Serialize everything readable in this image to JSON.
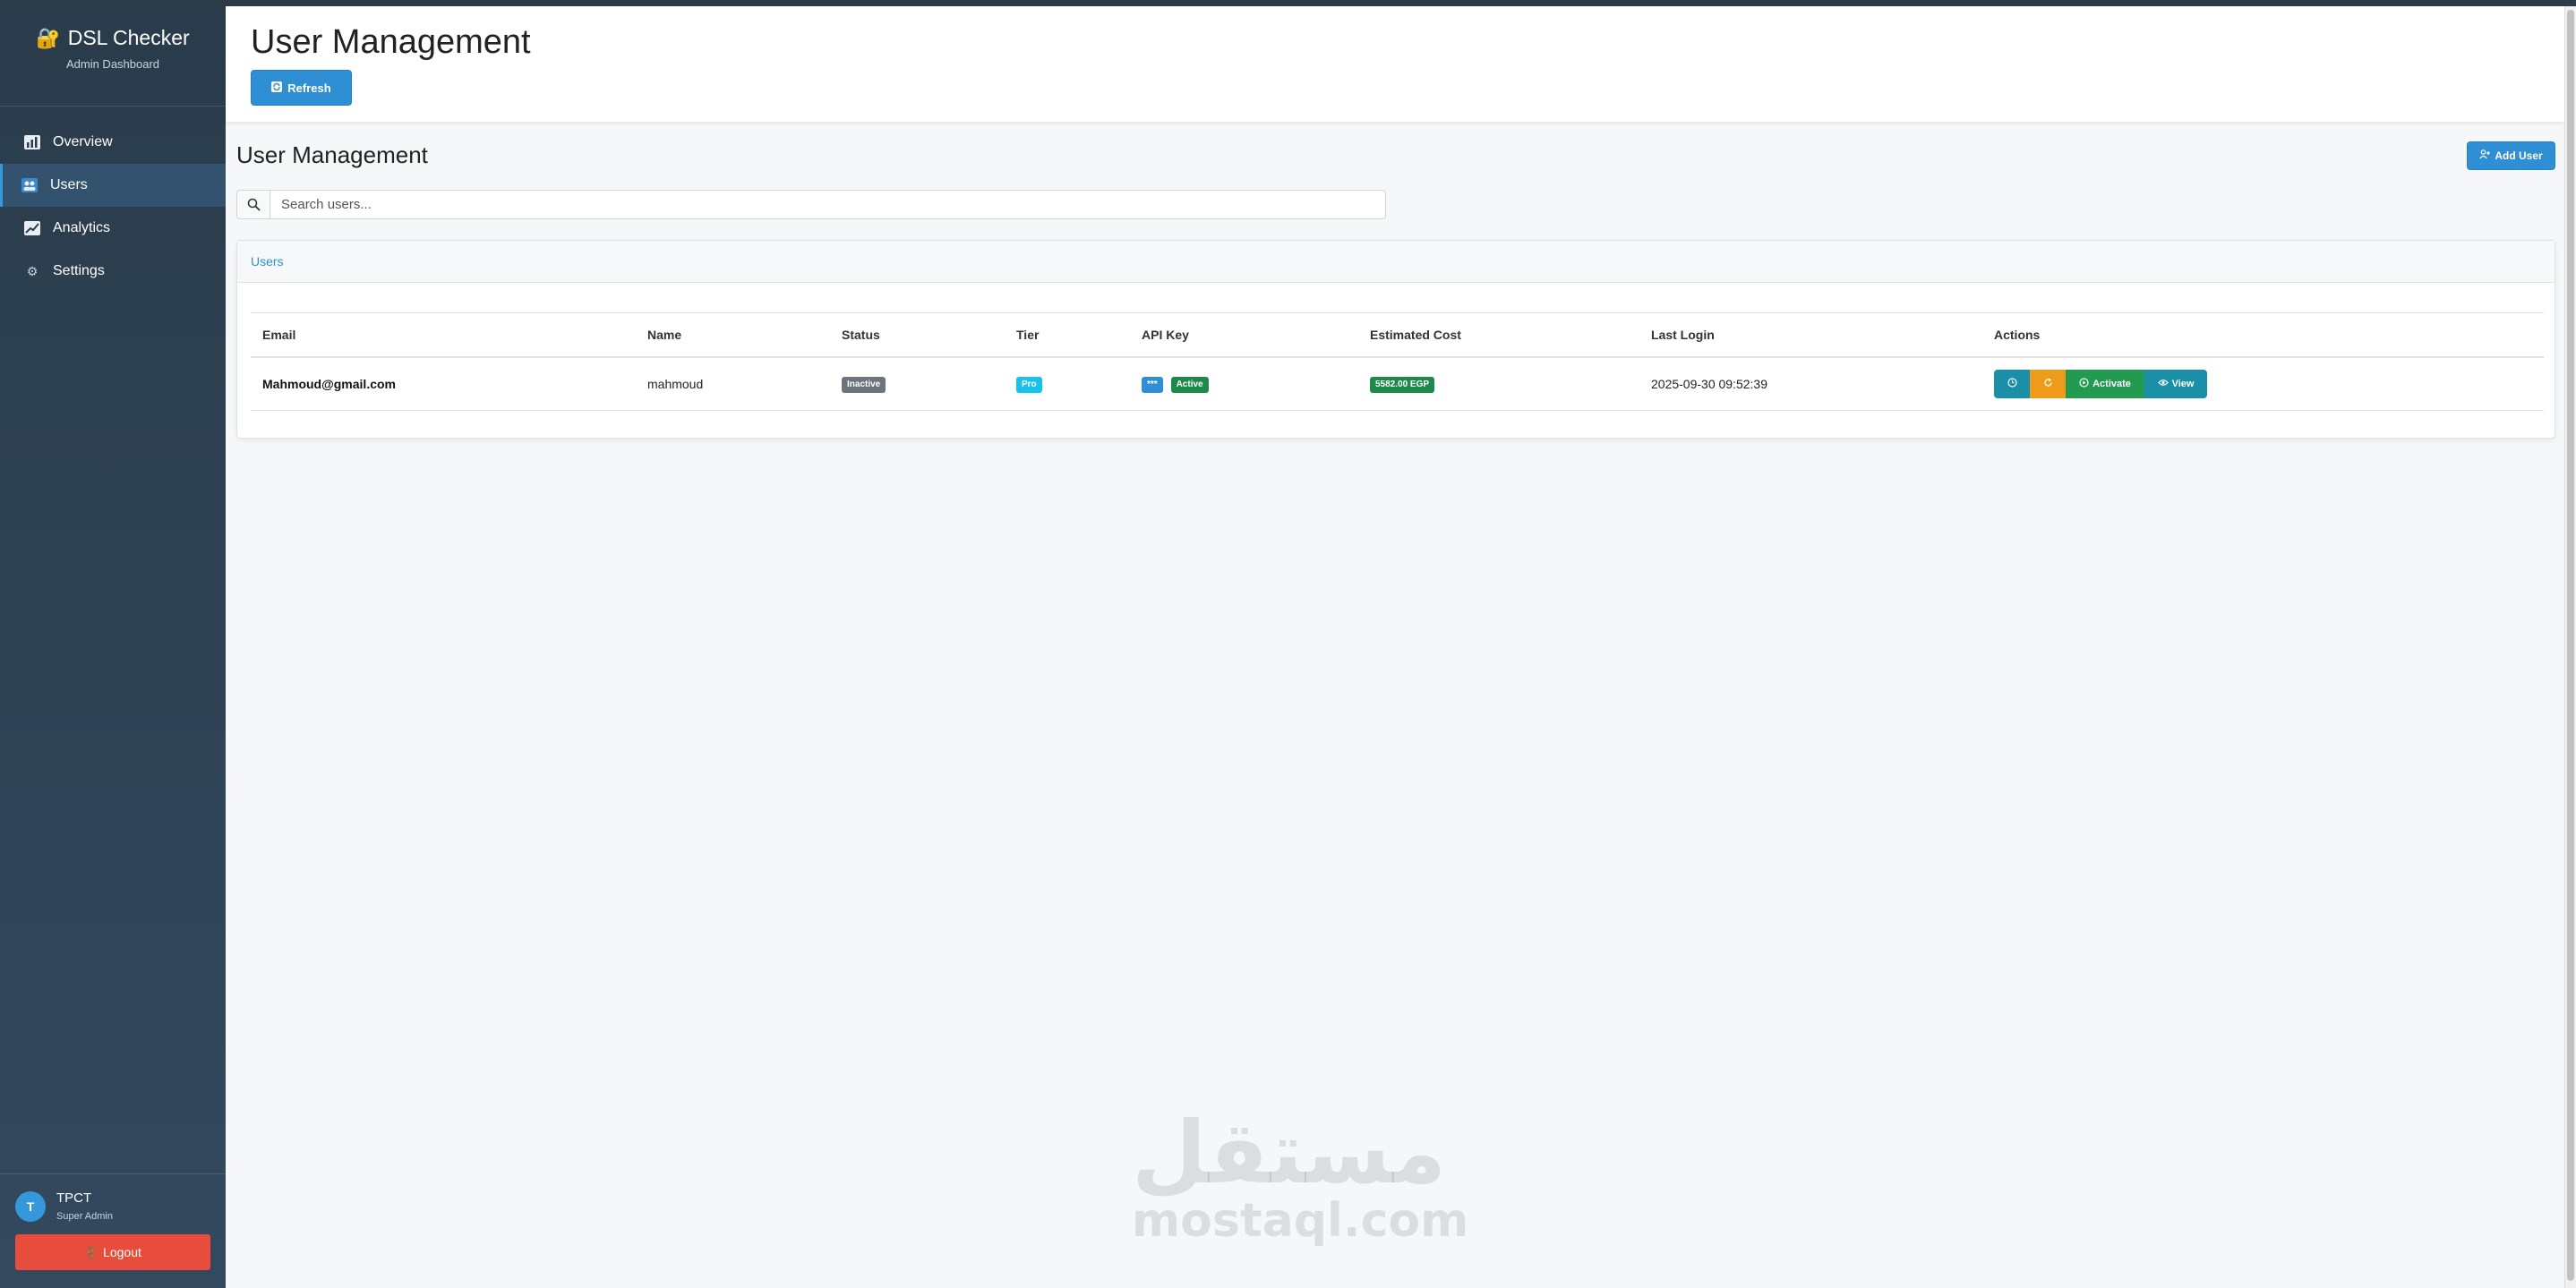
{
  "sidebar": {
    "brand_title": "DSL Checker",
    "brand_subtitle": "Admin Dashboard",
    "items": [
      {
        "label": "Overview",
        "icon": "chart-icon"
      },
      {
        "label": "Users",
        "icon": "users-icon",
        "active": true
      },
      {
        "label": "Analytics",
        "icon": "trend-icon"
      },
      {
        "label": "Settings",
        "icon": "gear-icon"
      }
    ],
    "user": {
      "initial": "T",
      "name": "TPCT",
      "role": "Super Admin"
    },
    "logout_label": "Logout"
  },
  "header": {
    "title": "User Management",
    "refresh_label": "Refresh"
  },
  "section": {
    "title": "User Management",
    "add_user_label": "Add User",
    "search_placeholder": "Search users..."
  },
  "card": {
    "tab_label": "Users",
    "columns": [
      "Email",
      "Name",
      "Status",
      "Tier",
      "API Key",
      "Estimated Cost",
      "Last Login",
      "Actions"
    ],
    "rows": [
      {
        "email": "Mahmoud@gmail.com",
        "name": "mahmoud",
        "status": "Inactive",
        "tier": "Pro",
        "api_key_masked": "***",
        "api_key_status": "Active",
        "estimated_cost": "5582.00 EGP",
        "last_login": "2025-09-30 09:52:39",
        "actions": {
          "activate_label": "Activate",
          "view_label": "View"
        }
      }
    ]
  },
  "watermark": {
    "arabic": "مستقل",
    "latin": "mostaql.com"
  },
  "colors": {
    "sidebar_bg": "#2a3c4b",
    "accent": "#2f8fd4",
    "danger": "#e74c3c",
    "success": "#1e8a4a",
    "warning": "#ee9a1a",
    "info": "#1a8fa8"
  }
}
